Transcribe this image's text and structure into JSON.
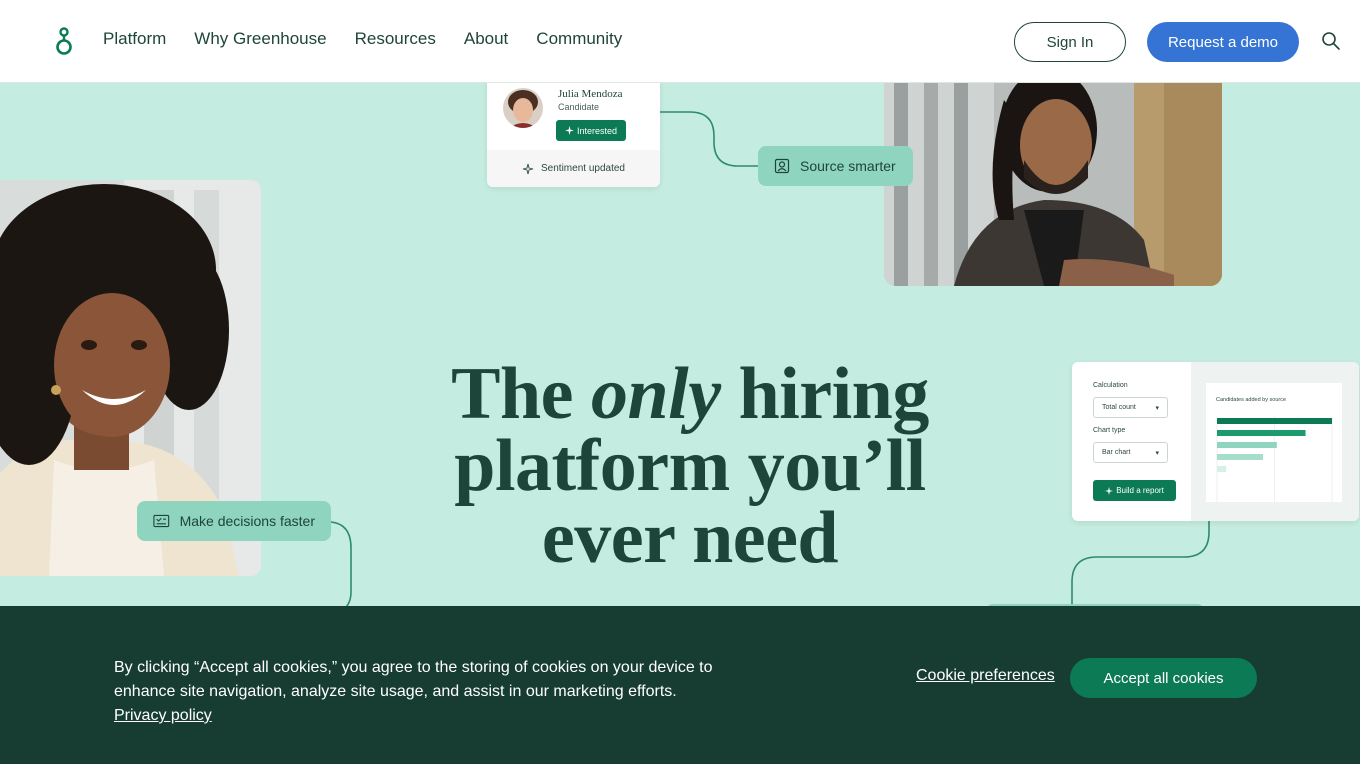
{
  "colors": {
    "hero_bg": "#c5ece0",
    "brand_dark": "#1e4539",
    "accent_blue": "#3574d4",
    "accent_green": "#0d7a56",
    "pill_bg": "#8fd4be",
    "banner_bg": "#173d33"
  },
  "header": {
    "logo_icon": "greenhouse-logo-icon",
    "nav": [
      "Platform",
      "Why Greenhouse",
      "Resources",
      "About",
      "Community"
    ],
    "sign_in_label": "Sign In",
    "demo_label": "Request a demo",
    "search_icon": "search-icon"
  },
  "hero": {
    "title_before": "The",
    "title_emph": "only",
    "title_after": "hiring platform you’ll ever need"
  },
  "candidate_card": {
    "name": "Julia Mendoza",
    "role": "Candidate",
    "badge": "Interested",
    "footer": "Sentiment updated"
  },
  "pills": {
    "source": "Source smarter",
    "decide": "Make decisions faster"
  },
  "report_card": {
    "calc_label": "Calculation",
    "calc_value": "Total count",
    "chart_type_label": "Chart type",
    "chart_type_value": "Bar chart",
    "button": "Build a report",
    "chart_data": {
      "type": "bar",
      "title": "Candidates added by source",
      "orientation": "horizontal",
      "categories": [
        "",
        "",
        "",
        "",
        ""
      ],
      "values": [
        100,
        77,
        52,
        40,
        8
      ],
      "xlim": [
        0,
        100
      ],
      "x_ticks": [
        "0",
        "50",
        "100"
      ]
    }
  },
  "cookie": {
    "text": "By clicking “Accept all cookies,” you agree to the storing of cookies on your device to enhance site navigation, analyze site usage, and assist in our marketing efforts.",
    "privacy": "Privacy policy",
    "prefs": "Cookie preferences",
    "accept": "Accept all cookies"
  }
}
